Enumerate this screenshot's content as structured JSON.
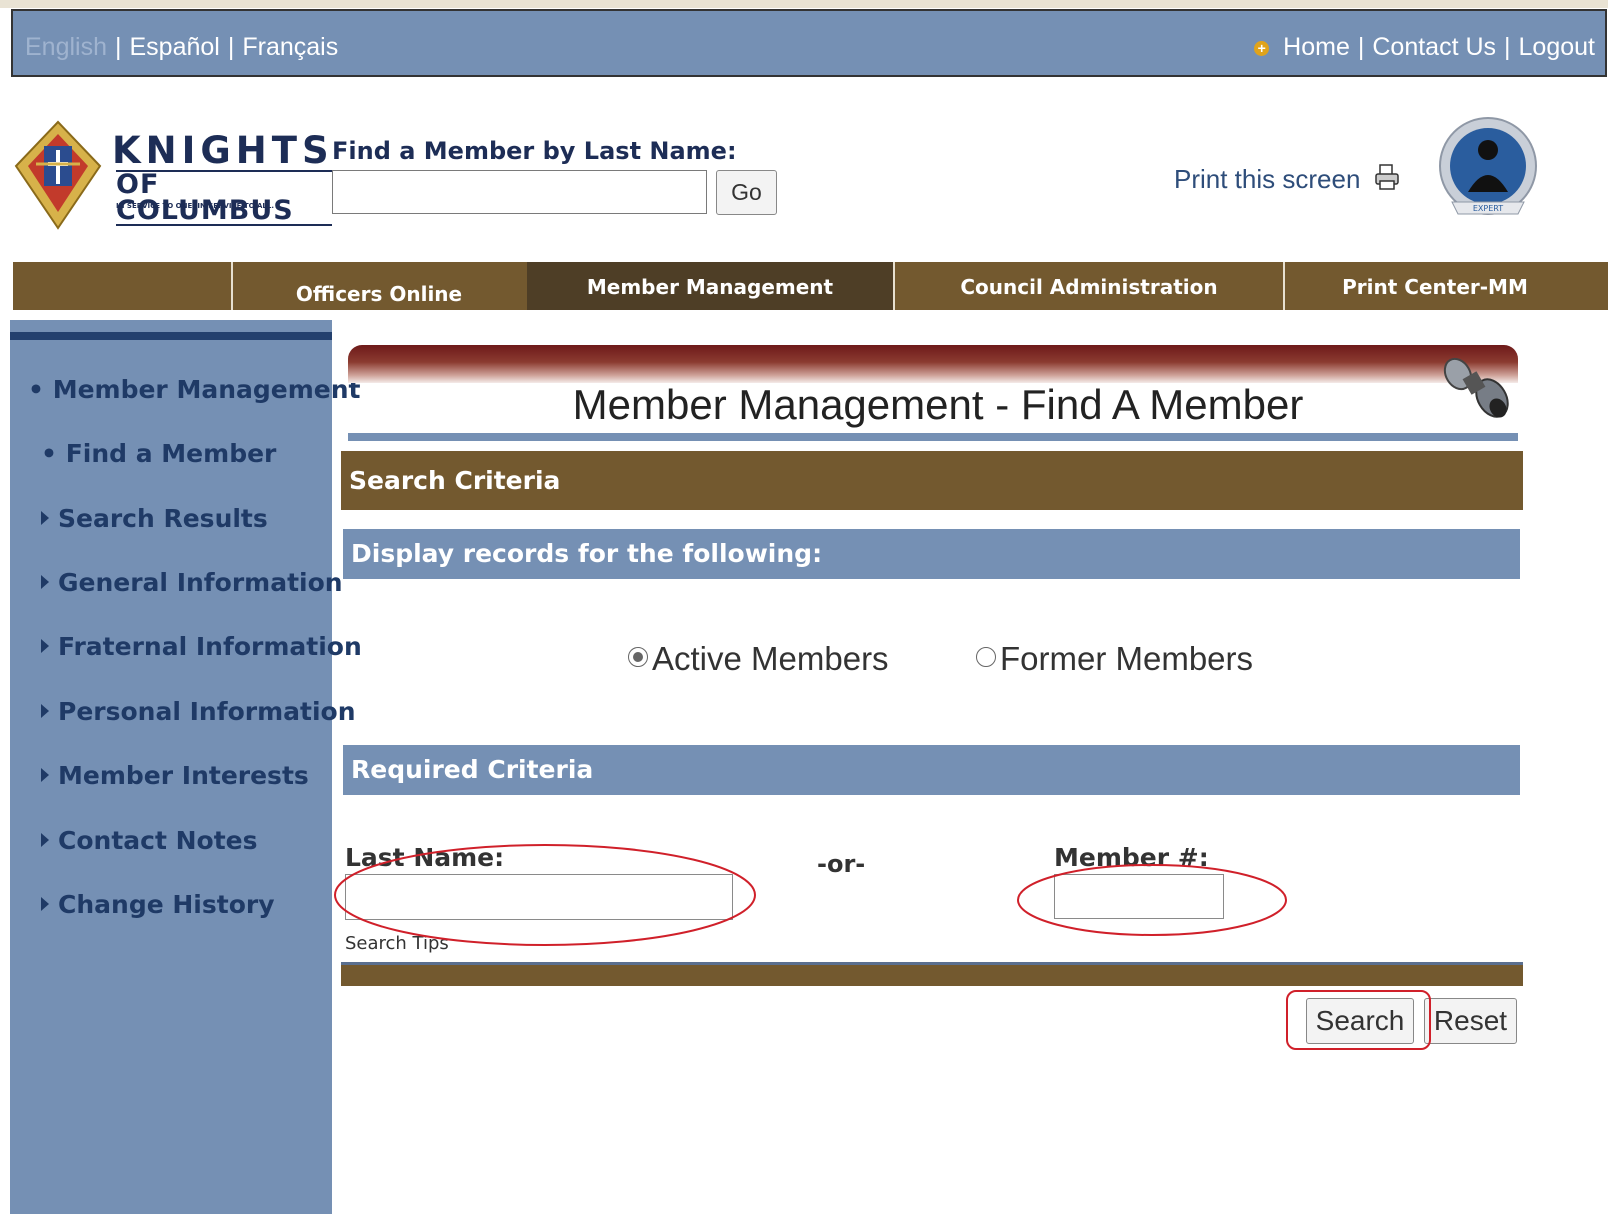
{
  "topbar": {
    "languages": [
      "English",
      "Español",
      "Français"
    ],
    "separator": "|",
    "links": [
      "Home",
      "Contact Us",
      "Logout"
    ]
  },
  "header": {
    "logo": {
      "line1": "KNIGHTS",
      "line2": "OF COLUMBUS",
      "tagline": "IN SERVICE TO ONE. IN SERVICE TO ALL."
    },
    "find_label": "Find a Member by Last Name:",
    "find_value": "",
    "go_label": "Go",
    "print_label": "Print this screen",
    "badge_label": "EXPERT"
  },
  "nav": {
    "tabs": [
      "Officers Online",
      "Member Management",
      "Council Administration",
      "Print Center-MM"
    ],
    "active": "Member Management"
  },
  "sidebar": {
    "items": [
      "Member Management",
      "Find a Member",
      "Search Results",
      "General Information",
      "Fraternal Information",
      "Personal Information",
      "Member Interests",
      "Contact Notes",
      "Change History"
    ]
  },
  "page": {
    "title": "Member Management - Find A Member",
    "search_criteria": "Search Criteria",
    "display_records": "Display records for the following:",
    "radio_active": "Active Members",
    "radio_former": "Former Members",
    "selected_radio": "Active Members",
    "required_criteria": "Required Criteria",
    "last_name_label": "Last Name:",
    "last_name_value": "",
    "or_label": "-or-",
    "member_label": "Member #:",
    "member_value": "",
    "search_tips": "Search Tips",
    "search_button": "Search",
    "reset_button": "Reset"
  },
  "colors": {
    "topbar": "#7590b4",
    "nav_brown": "#73592f",
    "nav_active": "#4e3e26",
    "sidebar_text": "#1f3a66",
    "annotation_red": "#d0202a"
  },
  "icons": [
    "globe-icon",
    "printer-icon",
    "expert-badge-icon",
    "binoculars-icon",
    "logo-emblem-icon"
  ]
}
